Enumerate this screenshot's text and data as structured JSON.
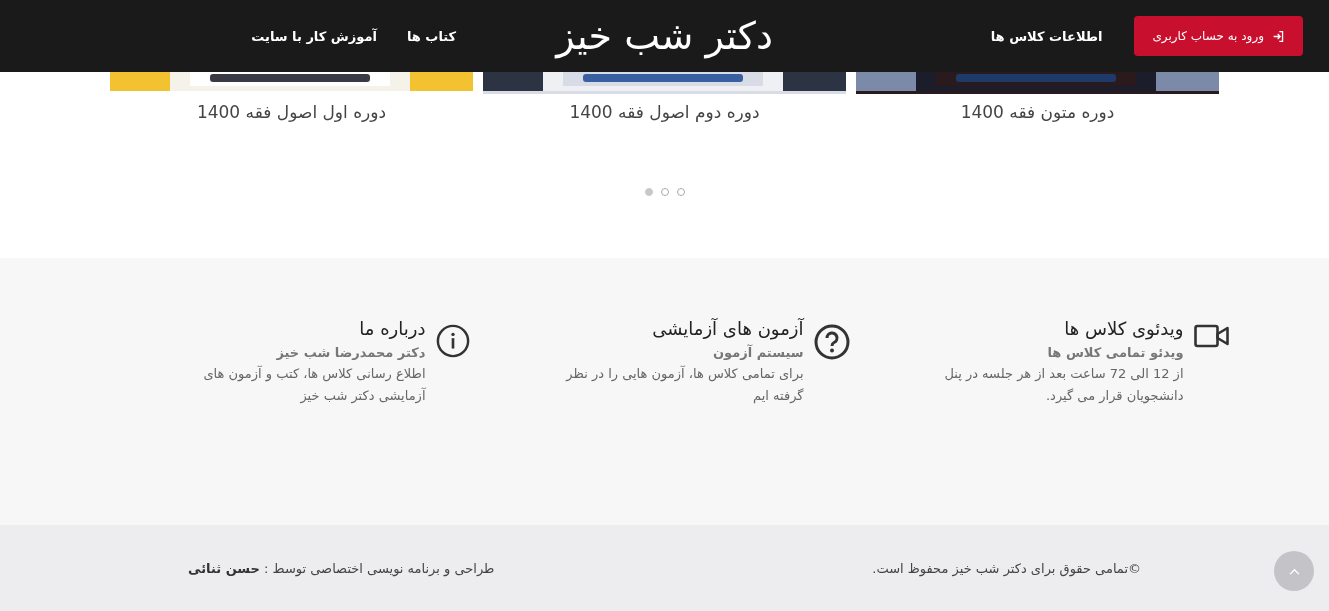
{
  "header": {
    "login_button": "ورود به حساب کاربری",
    "nav_right": [
      "اطلاعات کلاس ها"
    ],
    "logo": "دکتر شب خیز",
    "nav_left": [
      "کتاب ها",
      "آموزش کار با سایت"
    ]
  },
  "courses": [
    {
      "title": "دوره متون فقه 1400",
      "kind": "picture"
    },
    {
      "title": "دوره دوم اصول فقه 1400",
      "kind": "picture"
    },
    {
      "title": "دوره اول اصول فقه 1400",
      "kind": "picture"
    }
  ],
  "carousel_dots": [
    {
      "selected": true
    },
    {
      "selected": false
    },
    {
      "selected": false
    }
  ],
  "features": [
    {
      "kind": "video",
      "title": "ویدئوی کلاس ها",
      "subtitle": "ویدئو تمامی کلاس ها",
      "text": "از 12 الی 72 ساعت بعد از هر جلسه در پنل دانشجویان قرار می گیرد."
    },
    {
      "kind": "question",
      "title": "آزمون های آزمایشی",
      "subtitle": "سیستم آزمون",
      "text": "برای تمامی کلاس ها، آزمون هایی را در نظر گرفته ایم"
    },
    {
      "kind": "info",
      "title": "درباره ما",
      "subtitle": "دکتر محمدرضا شب خیز",
      "text": "اطلاع رسانی کلاس ها، کتب و آزمون های آزمایشی دکتر شب خیز"
    }
  ],
  "footer": {
    "copyright": "©تمامی حقوق برای دکتر شب خیز محفوظ است.",
    "credit": "طراحی و برنامه نویسی اختصاصی توسط : **حسن ثنائی**"
  }
}
